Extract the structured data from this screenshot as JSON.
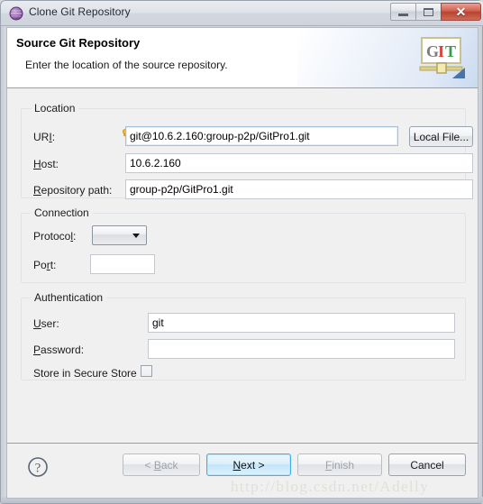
{
  "window": {
    "title": "Clone Git Repository",
    "icon": "eclipse-wizard-sphere-icon",
    "controls": {
      "minimize": "Minimize",
      "maximize": "Maximize",
      "close": "Close"
    }
  },
  "header": {
    "title": "Source Git Repository",
    "description": "Enter the location of the source repository.",
    "logo": {
      "letters": [
        "G",
        "I",
        "T"
      ],
      "colors": [
        "#7d7d7d",
        "#d6413a",
        "#3a9a4e"
      ]
    }
  },
  "groups": {
    "location": {
      "title": "Location",
      "uri": {
        "label": "URI:",
        "label_mnemonic_index": 2,
        "value": "git@10.6.2.160:group-p2p/GitPro1.git",
        "placeholder": "",
        "decoration_icon": "content-assist-hint-icon",
        "browse_button": "Local File..."
      },
      "host": {
        "label": "Host:",
        "label_mnemonic_index": 0,
        "value": "10.6.2.160",
        "placeholder": ""
      },
      "repository_path": {
        "label": "Repository path:",
        "label_mnemonic_index": 0,
        "value": "group-p2p/GitPro1.git",
        "placeholder": ""
      }
    },
    "connection": {
      "title": "Connection",
      "protocol": {
        "label": "Protocol:",
        "label_mnemonic_index": 7,
        "value": "",
        "arrow_icon": "chevron-down-icon"
      },
      "port": {
        "label": "Port:",
        "label_mnemonic_index": 3,
        "value": "",
        "placeholder": ""
      }
    },
    "authentication": {
      "title": "Authentication",
      "user": {
        "label": "User:",
        "label_mnemonic_index": 0,
        "value": "git",
        "placeholder": ""
      },
      "password": {
        "label": "Password:",
        "label_mnemonic_index": 0,
        "value": "",
        "placeholder": ""
      },
      "store_secure": {
        "label": "Store in Secure Store",
        "checked": false
      }
    }
  },
  "buttonbar": {
    "help_icon": "help-question-mark-icon",
    "back": {
      "label_pre": "< ",
      "label_mnemonic": "B",
      "label_post": "ack",
      "enabled": false
    },
    "next": {
      "label_pre": "",
      "label_mnemonic": "N",
      "label_post": "ext >",
      "enabled": true,
      "primary": true
    },
    "finish": {
      "label_pre": "",
      "label_mnemonic": "F",
      "label_post": "inish",
      "enabled": false
    },
    "cancel": {
      "label": "Cancel",
      "enabled": true
    }
  },
  "watermark": {
    "text": "http://blog.csdn.net/Adelly"
  }
}
